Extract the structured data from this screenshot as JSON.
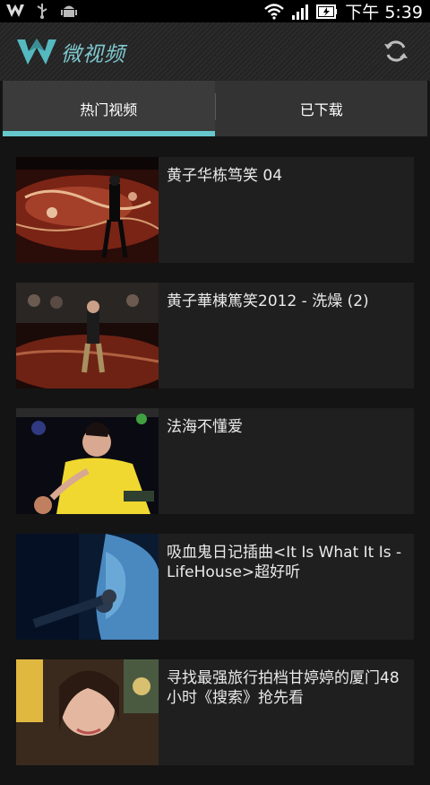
{
  "status_bar": {
    "time": "下午 5:39",
    "icons": [
      "app-logo-icon",
      "usb-icon",
      "android-icon",
      "wifi-icon",
      "signal-icon",
      "battery-icon"
    ]
  },
  "app_bar": {
    "title": "微视频",
    "logo": "w-logo-icon",
    "refresh_icon": "refresh-icon",
    "accent_color": "#66c8cc"
  },
  "tabs": [
    {
      "label": "热门视频",
      "selected": true
    },
    {
      "label": "已下载",
      "selected": false
    }
  ],
  "videos": [
    {
      "title": "黄子华栋笃笑 04"
    },
    {
      "title": "黄子華棟篤笑2012 - 洗燥 (2)"
    },
    {
      "title": "法海不懂爱"
    },
    {
      "title": "吸血鬼日记插曲<It Is What It Is - LifeHouse>超好听"
    },
    {
      "title": "寻找最强旅行拍档甘婷婷的厦门48小时《搜索》抢先看"
    }
  ]
}
